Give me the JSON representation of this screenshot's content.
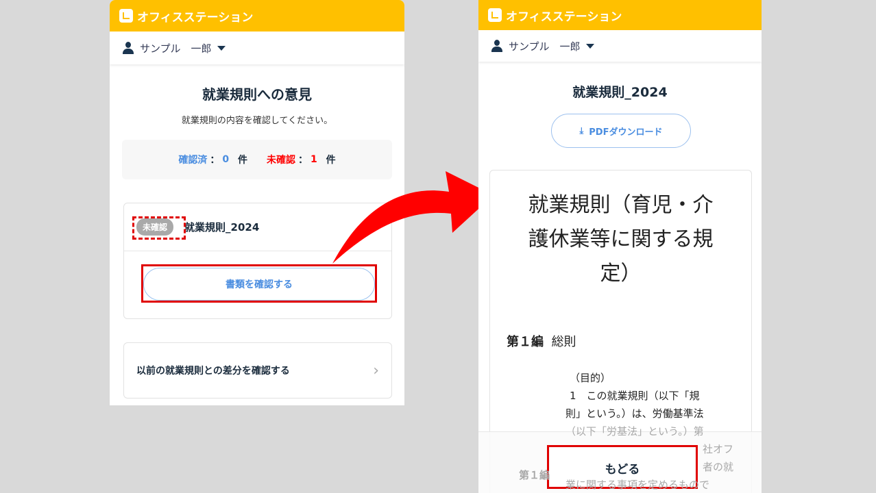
{
  "app": {
    "brand": "オフィスステーション",
    "user": "サンプル　一郎"
  },
  "left": {
    "title": "就業規則への意見",
    "subtitle": "就業規則の内容を確認してください。",
    "confirmed_label": "確認済",
    "confirmed_count": "0",
    "unconfirmed_label": "未確認",
    "unconfirmed_count": "1",
    "unit": "件",
    "sep": "：",
    "item": {
      "badge": "未確認",
      "name": "就業規則_2024",
      "button": "書類を確認する"
    },
    "diff_link": "以前の就業規則との差分を確認する"
  },
  "right": {
    "title": "就業規則_2024",
    "pdf_button": "PDFダウンロード",
    "doc_heading": [
      "就業規則（育児・介",
      "護休業等に関する規",
      "定）"
    ],
    "section": "第１編",
    "section_name": "総則",
    "purpose": "（目的）",
    "lines": [
      "1　この就業規則（以下「規",
      "則」という。）は、労働基準法",
      "（以下「労基法」という。）第",
      "社オフ",
      "者の就",
      "業に関する事項を定めるもので"
    ],
    "faded_section": "第１編",
    "back_button": "もどる"
  },
  "colors": {
    "brand": "#ffc000",
    "accent": "#4a8de0",
    "alert": "#ff0000"
  }
}
